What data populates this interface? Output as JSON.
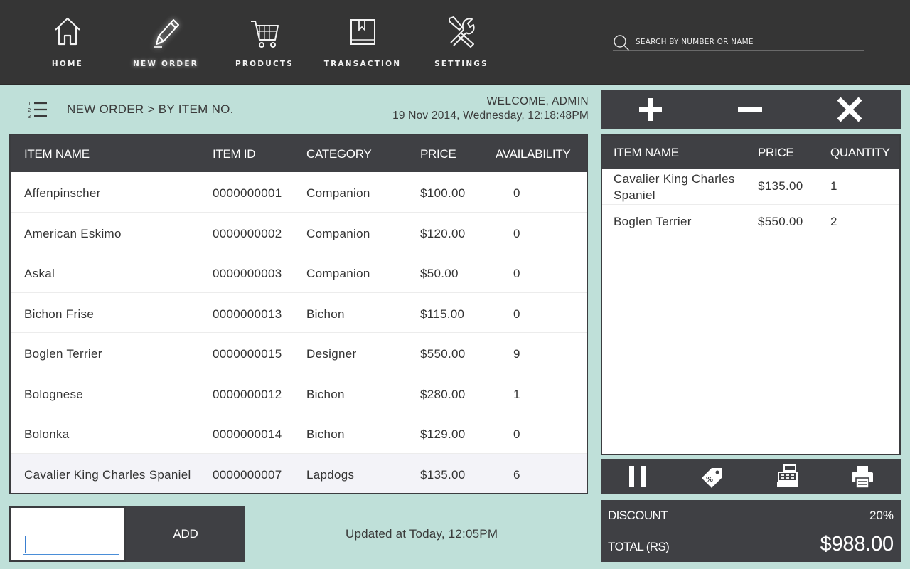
{
  "nav": {
    "items": [
      {
        "label": "HOME",
        "icon": "home-icon"
      },
      {
        "label": "NEW ORDER",
        "icon": "pencil-icon",
        "active": true
      },
      {
        "label": "PRODUCTS",
        "icon": "cart-icon"
      },
      {
        "label": "TRANSACTION",
        "icon": "book-icon"
      },
      {
        "label": "SETTINGS",
        "icon": "tools-icon"
      }
    ],
    "search_placeholder": "SEARCH BY NUMBER OR NAME"
  },
  "breadcrumb": "NEW ORDER > BY ITEM NO.",
  "welcome": "WELCOME, ADMIN",
  "datetime": "19 Nov 2014, Wednesday, 12:18:48PM",
  "items_table": {
    "headers": [
      "ITEM NAME",
      "ITEM ID",
      "CATEGORY",
      "PRICE",
      "AVAILABILITY"
    ],
    "rows": [
      [
        "Affenpinscher",
        "0000000001",
        "Companion",
        "$100.00",
        "0"
      ],
      [
        "American Eskimo",
        "0000000002",
        "Companion",
        "$120.00",
        "0"
      ],
      [
        "Askal",
        "0000000003",
        "Companion",
        "$50.00",
        "0"
      ],
      [
        "Bichon Frise",
        "0000000013",
        "Bichon",
        "$115.00",
        "0"
      ],
      [
        "Boglen Terrier",
        "0000000015",
        "Designer",
        "$550.00",
        "9"
      ],
      [
        "Bolognese",
        "0000000012",
        "Bichon",
        "$280.00",
        "1"
      ],
      [
        "Bolonka",
        "0000000014",
        "Bichon",
        "$129.00",
        "0"
      ],
      [
        "Cavalier King Charles Spaniel",
        "0000000007",
        "Lapdogs",
        "$135.00",
        "6"
      ]
    ]
  },
  "add_input_value": "",
  "add_label": "ADD",
  "updated": "Updated at Today, 12:05PM",
  "cart": {
    "headers": [
      "ITEM NAME",
      "PRICE",
      "QUANTITY"
    ],
    "rows": [
      [
        "Cavalier King Charles Spaniel",
        "$135.00",
        "1"
      ],
      [
        "Boglen Terrier",
        "$550.00",
        "2"
      ]
    ]
  },
  "summary": {
    "discount_label": "DISCOUNT",
    "discount_value": "20%",
    "total_label": "TOTAL (RS)",
    "total_value": "$988.00"
  },
  "colors": {
    "background": "#bfe0d9",
    "dark_panel": "#3f4044",
    "topbar": "#353535"
  }
}
